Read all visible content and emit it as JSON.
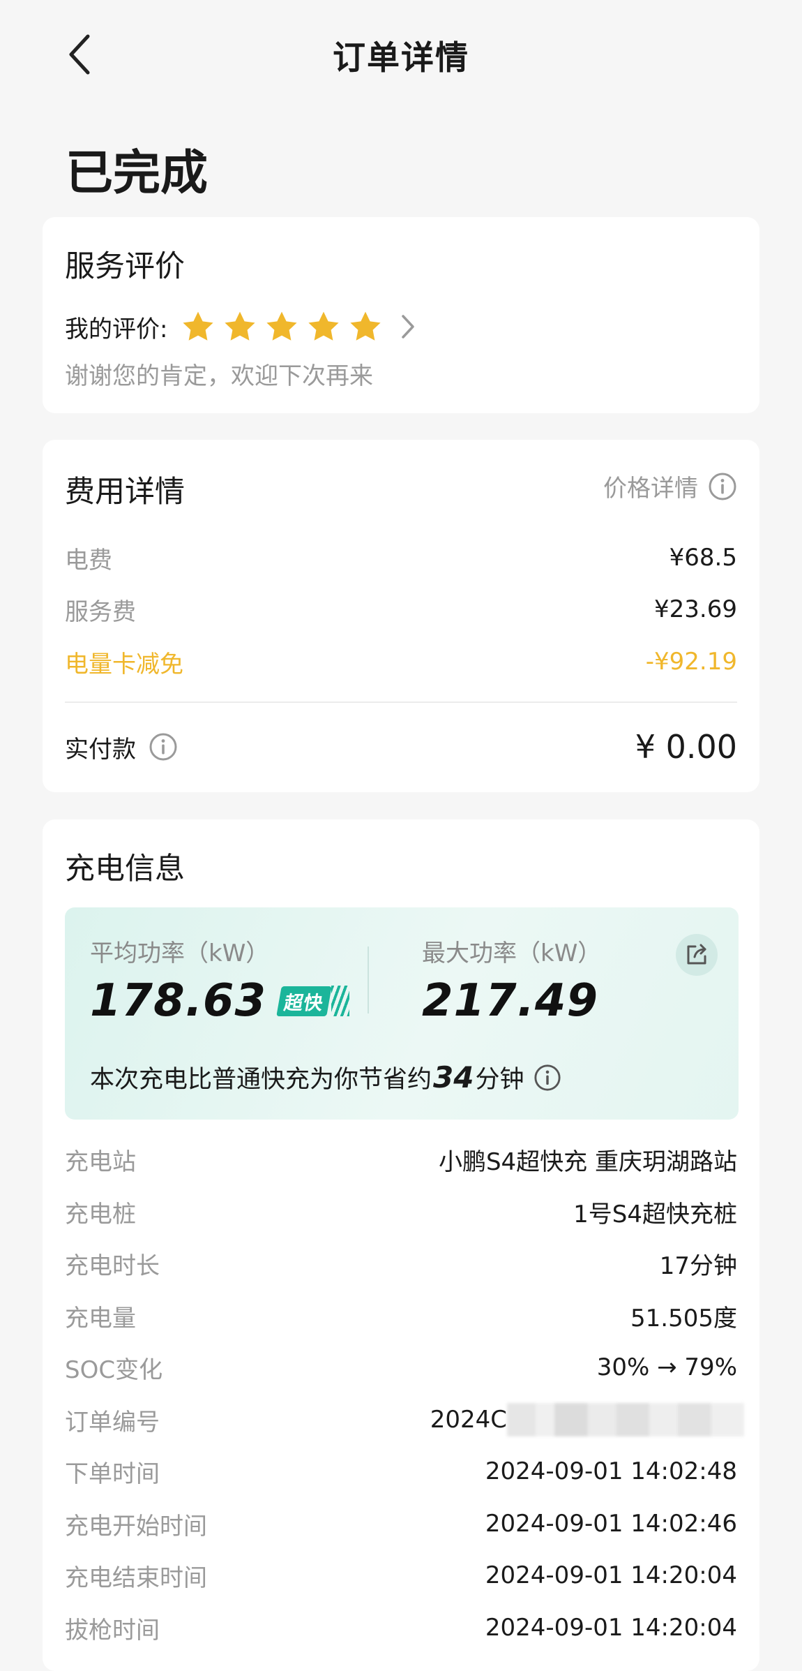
{
  "nav": {
    "title": "订单详情"
  },
  "status": "已完成",
  "review": {
    "title": "服务评价",
    "label": "我的评价:",
    "stars": 5,
    "max_stars": 5,
    "thanks": "谢谢您的肯定，欢迎下次再来"
  },
  "fee": {
    "title": "费用详情",
    "price_detail": "价格详情",
    "items": [
      {
        "label": "电费",
        "value": "¥68.5"
      },
      {
        "label": "服务费",
        "value": "¥23.69"
      },
      {
        "label": "电量卡减免",
        "value": "-¥92.19"
      }
    ],
    "paid_label": "实付款",
    "paid_value": "¥ 0.00"
  },
  "charge": {
    "title": "充电信息",
    "avg_label": "平均功率（kW）",
    "avg_value": "178.63",
    "badge": "超快",
    "max_label": "最大功率（kW）",
    "max_value": "217.49",
    "save_prefix": "本次充电比普通快充为你节省约",
    "save_minutes": "34",
    "save_suffix": "分钟",
    "rows": [
      {
        "label": "充电站",
        "value": "小鹏S4超快充 重庆玥湖路站"
      },
      {
        "label": "充电桩",
        "value": "1号S4超快充桩"
      },
      {
        "label": "充电时长",
        "value": "17分钟"
      },
      {
        "label": "充电量",
        "value": "51.505度"
      },
      {
        "label": "SOC变化",
        "value": "30% → 79%"
      },
      {
        "label": "订单编号",
        "value": "2024C"
      },
      {
        "label": "下单时间",
        "value": "2024-09-01 14:02:48"
      },
      {
        "label": "充电开始时间",
        "value": "2024-09-01 14:02:46"
      },
      {
        "label": "充电结束时间",
        "value": "2024-09-01 14:20:04"
      },
      {
        "label": "拔枪时间",
        "value": "2024-09-01 14:20:04"
      }
    ]
  },
  "colors": {
    "star": "#f0b72c",
    "discount": "#f0b72c",
    "badge": "#1bb59a"
  }
}
